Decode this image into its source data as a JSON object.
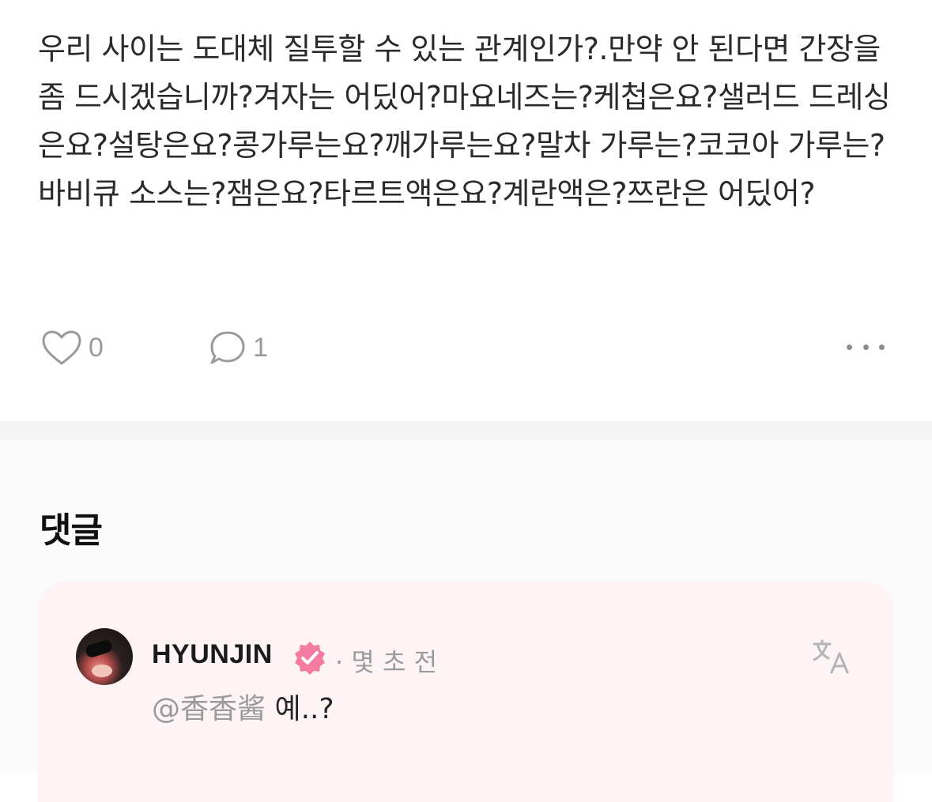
{
  "post": {
    "body": "우리 사이는 도대체 질투할 수 있는 관계인가?.만약 안 된다면 간장을 좀 드시겠습니까?겨자는 어딨어?마요네즈는?케첩은요?샐러드 드레싱은요?설탕은요?콩가루는요?깨가루는요?말차 가루는?코코아 가루는?바비큐 소스는?잼은요?타르트액은요?계란액은?쯔란은 어딨어?",
    "like_count": "0",
    "comment_count": "1"
  },
  "comments": {
    "title": "댓글",
    "items": [
      {
        "username": "HYUNJIN",
        "time": "· 몇 초 전",
        "mention": "@香香酱",
        "text": "예..?"
      }
    ]
  },
  "icons": {
    "like": "heart-outline-icon",
    "comment": "speech-bubble-icon",
    "more": "ellipsis-icon",
    "verified": "verified-badge-icon",
    "translate": "translate-icon"
  },
  "colors": {
    "verified_badge": "#f47ba2",
    "comment_card_bg": "#fff4f5",
    "muted_text": "#9a9a9a"
  }
}
